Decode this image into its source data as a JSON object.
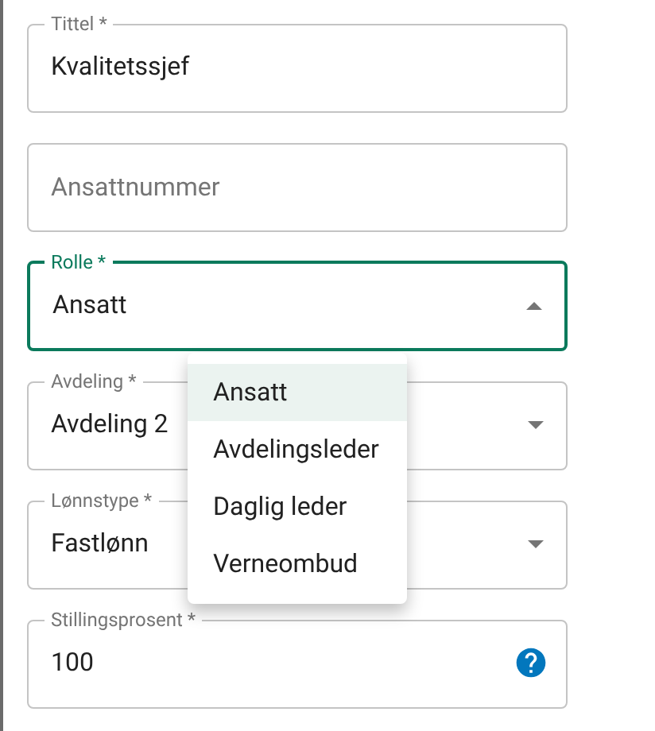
{
  "fields": [
    {
      "kind": "text",
      "label": "Tittel *",
      "value": "Kvalitetssjef",
      "focused": false
    },
    {
      "kind": "text",
      "placeholder": "Ansattnummer",
      "focused": false
    },
    {
      "kind": "select",
      "label": "Rolle *",
      "value": "Ansatt",
      "focused": true,
      "expanded": true
    },
    {
      "kind": "select",
      "label": "Avdeling *",
      "value": "Avdeling 2",
      "focused": false,
      "expanded": false
    },
    {
      "kind": "select",
      "label": "Lønnstype *",
      "value": "Fastlønn",
      "focused": false,
      "expanded": false
    },
    {
      "kind": "help",
      "label": "Stillingsprosent *",
      "value": "100",
      "focused": false
    }
  ],
  "menu": {
    "options": [
      {
        "label": "Ansatt",
        "selected": true
      },
      {
        "label": "Avdelingsleder",
        "selected": false
      },
      {
        "label": "Daglig leder",
        "selected": false
      },
      {
        "label": "Verneombud",
        "selected": false
      }
    ]
  }
}
